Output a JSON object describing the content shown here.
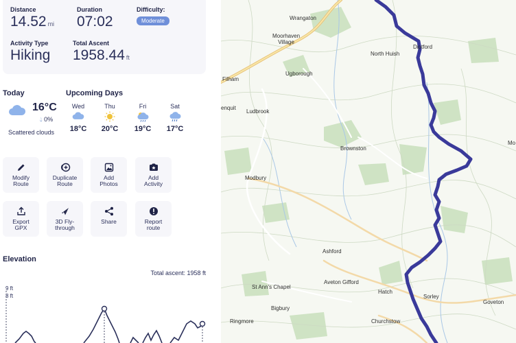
{
  "stats": {
    "distance": {
      "label": "Distance",
      "value": "14.52",
      "unit": "mi"
    },
    "duration": {
      "label": "Duration",
      "value": "07:02"
    },
    "difficulty": {
      "label": "Difficulty:",
      "value": "Moderate"
    },
    "activity_type": {
      "label": "Activity Type",
      "value": "Hiking"
    },
    "total_ascent": {
      "label": "Total Ascent",
      "value": "1958.44",
      "unit": "ft"
    }
  },
  "weather": {
    "today_label": "Today",
    "upcoming_label": "Upcoming Days",
    "today": {
      "temp": "16°C",
      "precip": "0%",
      "condition": "Scattered clouds",
      "icon": "cloud-icon"
    },
    "days": [
      {
        "name": "Wed",
        "temp": "18°C",
        "icon": "cloud-icon"
      },
      {
        "name": "Thu",
        "temp": "20°C",
        "icon": "sun-icon"
      },
      {
        "name": "Fri",
        "temp": "19°C",
        "icon": "sun-cloud-rain-icon"
      },
      {
        "name": "Sat",
        "temp": "17°C",
        "icon": "cloud-rain-icon"
      }
    ]
  },
  "actions": [
    {
      "label": "Modify\nRoute",
      "icon": "pencil-icon"
    },
    {
      "label": "Duplicate\nRoute",
      "icon": "duplicate-icon"
    },
    {
      "label": "Add\nPhotos",
      "icon": "photo-icon"
    },
    {
      "label": "Add\nActivity",
      "icon": "activity-icon"
    },
    {
      "label": "Export\nGPX",
      "icon": "export-icon"
    },
    {
      "label": "3D Fly-\nthrough",
      "icon": "flythrough-icon"
    },
    {
      "label": "Share",
      "icon": "share-icon"
    },
    {
      "label": "Report\nroute",
      "icon": "report-icon"
    }
  ],
  "elevation": {
    "title": "Elevation",
    "total_ascent_text": "Total ascent: 1958 ft",
    "y_ticks": [
      "9 ft",
      "8 ft"
    ]
  },
  "map": {
    "route_color": "#3a3a9a",
    "towns": [
      "Wrangaton",
      "Moorhaven\nVillage",
      "North Huish",
      "Diptford",
      "Ugborough",
      "Filham",
      "Ludbrook",
      "enquit",
      "Brownston",
      "Modbury",
      "Mo",
      "Ashford",
      "St Ann's Chapel",
      "Aveton Gifford",
      "Hatch",
      "Sorley",
      "Goveton",
      "Bigbury",
      "Ringmore",
      "Churchstow"
    ]
  },
  "colors": {
    "accent": "#6f8fd9",
    "card_bg": "#f6f6fa",
    "text": "#1f2347"
  }
}
